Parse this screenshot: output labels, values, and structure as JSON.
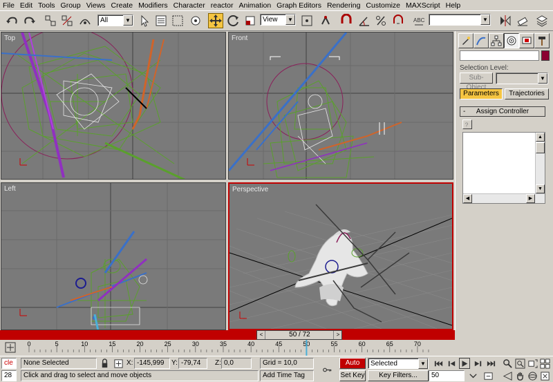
{
  "menu": [
    "File",
    "Edit",
    "Tools",
    "Group",
    "Views",
    "Create",
    "Modifiers",
    "Character",
    "reactor",
    "Animation",
    "Graph Editors",
    "Rendering",
    "Customize",
    "MAXScript",
    "Help"
  ],
  "toolbar": {
    "selection_filter": "All",
    "ref_coord": "View",
    "named_selection": ""
  },
  "viewports": {
    "top": "Top",
    "front": "Front",
    "left": "Left",
    "perspective": "Perspective"
  },
  "command_panel": {
    "object_name": "",
    "color": "#8b0030",
    "selection_level_label": "Selection Level:",
    "sub_object_label": "Sub-Object",
    "tab_parameters": "Parameters",
    "tab_trajectories": "Trajectories",
    "rollout_minus": "-",
    "rollout_title": "Assign Controller"
  },
  "timeline": {
    "frame_counter": "50 / 72",
    "current_frame": 50,
    "total_frames": 72,
    "ticks": [
      "0",
      "5",
      "10",
      "15",
      "20",
      "25",
      "30",
      "35",
      "40",
      "45",
      "50",
      "55",
      "60",
      "65",
      "70"
    ]
  },
  "status": {
    "listener": "cle",
    "listener_num": "28",
    "selection": "None Selected",
    "x_label": "X:",
    "x_value": "-145,999",
    "y_label": "Y:",
    "y_value": "-79,74",
    "z_label": "Z:",
    "z_value": "0,0",
    "grid": "Grid = 10,0",
    "add_time_tag": "Add Time Tag",
    "prompt": "Click and drag to select and move objects",
    "auto_key": "Auto Key",
    "set_key": "Set Key",
    "key_mode": "Selected",
    "key_filters": "Key Filters...",
    "current_frame_field": "50"
  },
  "colors": {
    "active_border": "#c00000",
    "highlight": "#f5c542",
    "viewport_bg": "#7a7a7a"
  }
}
